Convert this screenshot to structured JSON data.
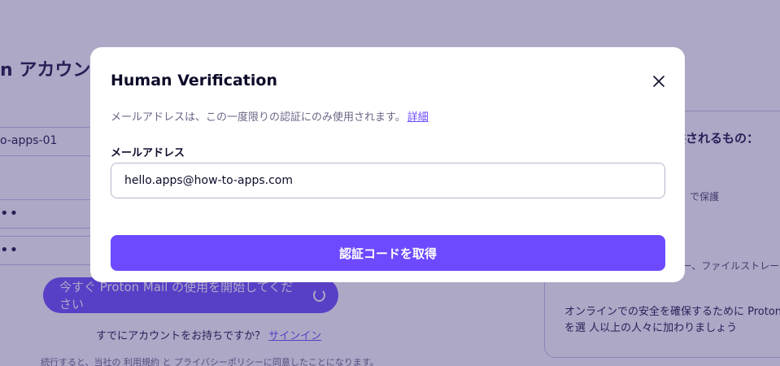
{
  "background": {
    "heading": "n アカウントを",
    "username_value": "o-apps-01",
    "password_mask": "••",
    "confirm_mask": "••",
    "start_button_label": "今すぐ Proton Mail の使用を開始してください",
    "signin_prompt": "すでにアカウントをお持ちですか？",
    "signin_link": "サインイン",
    "terms_text": "続行すると、当社の 利用規約 と プライバシーポリシーに同意したことになります。",
    "panel": {
      "title": "提供されるもの：",
      "item1": "で保護",
      "item2": "ジャー、ファイルストレージ、",
      "bottom_text": "オンラインでの安全を確保するために Proton を選 人以上の人々に加わりましょう"
    }
  },
  "modal": {
    "title": "Human Verification",
    "description": "メールアドレスは、この一度限りの認証にのみ使用されます。",
    "details_link": "詳細",
    "email_label": "メールアドレス",
    "email_value": "hello.apps@how-to-apps.com",
    "submit_label": "認証コードを取得"
  },
  "colors": {
    "accent": "#6d4aff",
    "overlay": "#3c3078"
  },
  "icons": {
    "close": "close-icon"
  }
}
